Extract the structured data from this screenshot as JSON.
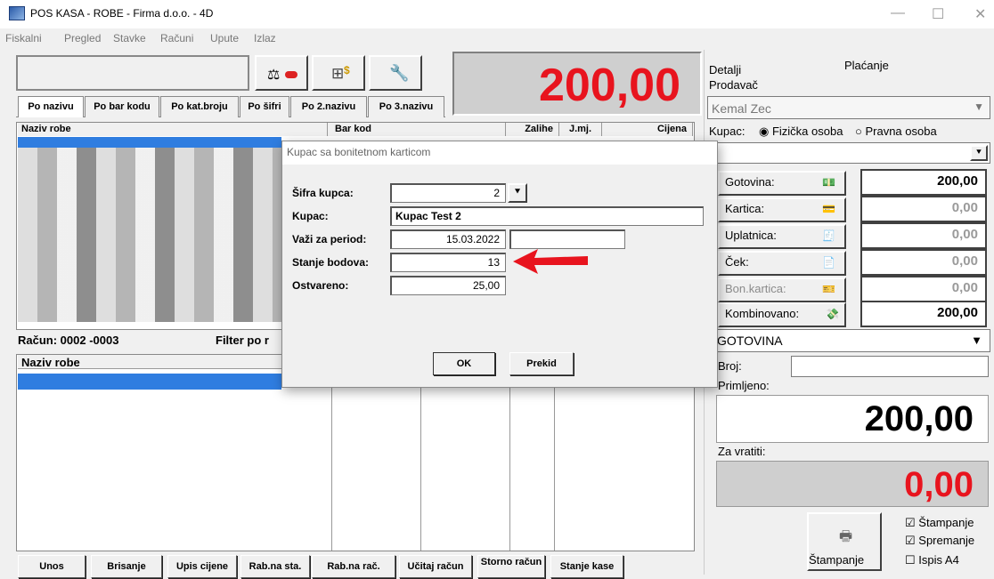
{
  "window": {
    "title": "POS KASA - ROBE - Firma d.o.o. - 4D",
    "minimize": "—",
    "maximize": "☐",
    "close": "✕"
  },
  "menu": [
    "Fiskalni",
    "Pregled",
    "Stavke",
    "Računi",
    "Upute",
    "Izlaz"
  ],
  "total_display": "200,00",
  "search_tabs": [
    "Po nazivu",
    "Po bar kodu",
    "Po kat.broju",
    "Po šifri",
    "Po 2.nazivu",
    "Po 3.nazivu"
  ],
  "product_columns": {
    "name": "Naziv robe",
    "barcode": "Bar kod",
    "stock": "Zalihe",
    "unit": "J.mj.",
    "price": "Cijena"
  },
  "receipt": {
    "label": "Račun: 0002 -0003",
    "filter_label": "Filter po r",
    "column": "Naziv robe"
  },
  "bottom_buttons": [
    "Unos",
    "Brisanje",
    "Upis cijene",
    "Rab.na sta.",
    "Rab.na rač.",
    "Učitaj račun",
    "Storno račun",
    "Stanje kase"
  ],
  "right_panel": {
    "tab_details": "Detalji",
    "tab_payment": "Plaćanje",
    "seller_label": "Prodavač",
    "seller_value": "Kemal Zec",
    "customer_label": "Kupac:",
    "radio_physical": "Fizička osoba",
    "radio_legal": "Pravna osoba",
    "payments": [
      {
        "label": "Gotovina:",
        "value": "200,00",
        "icon": "cash-icon",
        "dim": false
      },
      {
        "label": "Kartica:",
        "value": "0,00",
        "icon": "card-icon",
        "dim": true
      },
      {
        "label": "Uplatnica:",
        "value": "0,00",
        "icon": "slip-icon",
        "dim": true
      },
      {
        "label": "Ček:",
        "value": "0,00",
        "icon": "check-icon",
        "dim": true
      },
      {
        "label": "Bon.kartica:",
        "value": "0,00",
        "icon": "voucher-icon",
        "dim": true
      },
      {
        "label": "Kombinovano:",
        "value": "200,00",
        "icon": "combined-icon",
        "dim": false
      }
    ],
    "payment_type": "GOTOVINA",
    "number_label": "Broj:",
    "received_label": "Primljeno:",
    "received_value": "200,00",
    "change_label": "Za vratiti:",
    "change_value": "0,00",
    "print_label": "Štampanje",
    "checkboxes": [
      {
        "label": "Štampanje",
        "checked": true
      },
      {
        "label": "Spremanje",
        "checked": true
      },
      {
        "label": "Ispis A4",
        "checked": false
      }
    ]
  },
  "dialog": {
    "title": "Kupac sa bonitetnom karticom",
    "fields": {
      "customer_id_label": "Šifra kupca:",
      "customer_id": "2",
      "customer_label": "Kupac:",
      "customer": "Kupac Test 2",
      "period_label": "Važi za period:",
      "period_from": "15.03.2022",
      "period_to": "",
      "points_label": "Stanje bodova:",
      "points": "13",
      "achieved_label": "Ostvareno:",
      "achieved": "25,00"
    },
    "ok": "OK",
    "cancel": "Prekid"
  },
  "colors": {
    "total_red": "#e8141e",
    "selection_blue": "#2f7de0",
    "arrow_red": "#e8141e"
  }
}
